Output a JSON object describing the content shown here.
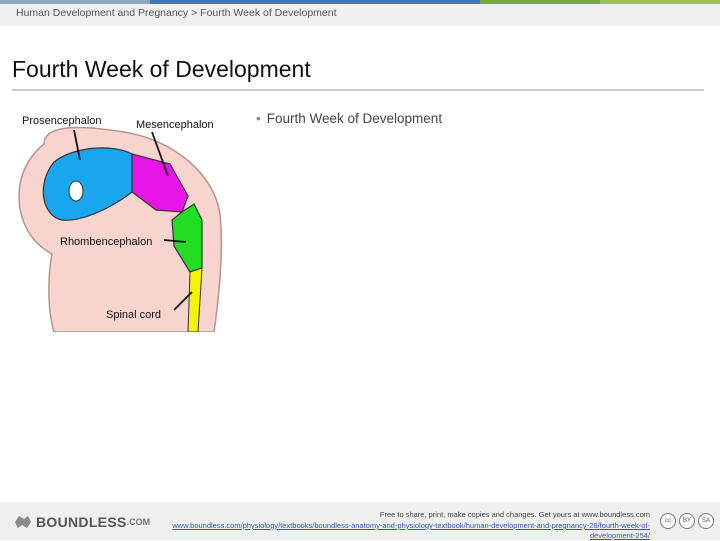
{
  "header": {
    "breadcrumb": "Human Development and Pregnancy > Fourth Week of Development",
    "accent_colors": [
      "#8aa7c1",
      "#3d78b8",
      "#7aaa3a",
      "#9dc14a"
    ]
  },
  "slide": {
    "title": "Fourth Week of Development",
    "bullets": [
      "Fourth Week of Development"
    ]
  },
  "figure": {
    "labels": {
      "prosencephalon": "Prosencephalon",
      "mesencephalon": "Mesencephalon",
      "rhombencephalon": "Rhombencephalon",
      "spinal_cord": "Spinal cord"
    },
    "colors": {
      "prosencephalon": "#1aa6ef",
      "mesencephalon": "#e815e8",
      "rhombencephalon": "#22dd22",
      "spinal_cord": "#f4f40a",
      "embryo": "#f7d4cd"
    }
  },
  "footer": {
    "logo_text": "BOUNDLESS",
    "logo_domain": ".COM",
    "note": "Free to share, print, make copies and changes. Get yours at www.boundless.com",
    "link": "www.boundless.com/physiology/textbooks/boundless-anatomy-and-physiology-textbook/human-development-and-pregnancy-28/fourth-week-of-development-254/",
    "license_icons": [
      "cc-icon",
      "by-icon",
      "sa-icon"
    ]
  }
}
